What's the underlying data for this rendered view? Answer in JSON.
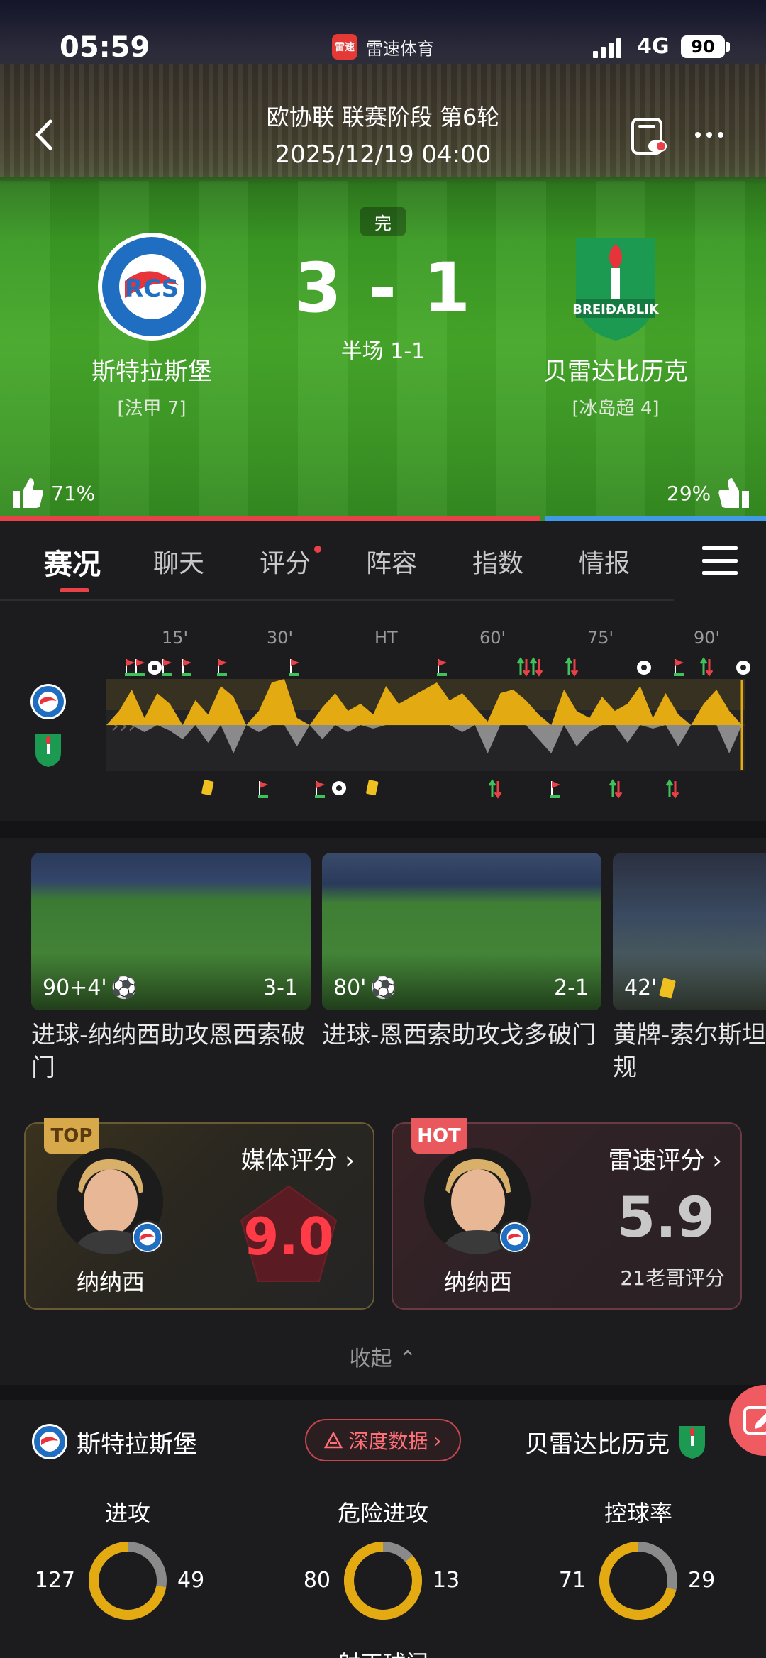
{
  "status_bar": {
    "time": "05:59",
    "app_name": "雷速体育",
    "app_logo_text": "雷速",
    "network": "4G",
    "battery": "90"
  },
  "header": {
    "competition": "欧协联 联赛阶段 第6轮",
    "datetime": "2025/12/19 04:00"
  },
  "match": {
    "status": "完",
    "score": "3 - 1",
    "halftime": "半场 1-1",
    "home": {
      "name": "斯特拉斯堡",
      "league": "[法甲 7]",
      "vote": "71%",
      "vote_value": 71
    },
    "away": {
      "name": "贝雷达比历克",
      "league": "[冰岛超 4]",
      "vote": "29%",
      "vote_value": 29
    }
  },
  "tabs": [
    {
      "label": "赛况",
      "active": true
    },
    {
      "label": "聊天"
    },
    {
      "label": "评分",
      "dot": true
    },
    {
      "label": "阵容"
    },
    {
      "label": "指数"
    },
    {
      "label": "情报"
    }
  ],
  "timeline": {
    "labels": [
      "15'",
      "30'",
      "HT",
      "60'",
      "75'",
      "90'"
    ],
    "colors": {
      "home": "#e4aa12",
      "away": "#8a8a8a",
      "corner": "#e84147",
      "sub_in": "#3fc25a",
      "yellow": "#f0c020"
    }
  },
  "highlights": [
    {
      "minute": "90+4'",
      "score": "3-1",
      "title": "进球-纳纳西助攻恩西索破门",
      "icon": "goal-icon"
    },
    {
      "minute": "80'",
      "score": "2-1",
      "title": "进球-恩西索助攻戈多破门",
      "icon": "goal-icon"
    },
    {
      "minute": "42'",
      "score": "",
      "title": "黄牌-索尔斯坦比历克) 犯规",
      "icon": "yellow-card-icon"
    }
  ],
  "ratings": {
    "media": {
      "ribbon": "TOP",
      "label": "媒体评分",
      "player": "纳纳西",
      "value": "9.0"
    },
    "fans": {
      "ribbon": "HOT",
      "label": "雷速评分",
      "player": "纳纳西",
      "value": "5.9",
      "count": "21老哥评分"
    }
  },
  "collapse_label": "收起",
  "stats": {
    "home_team": "斯特拉斯堡",
    "away_team": "贝雷达比历克",
    "deep_data": "深度数据",
    "items": [
      {
        "title": "进攻",
        "home": "127",
        "away": "49"
      },
      {
        "title": "危险进攻",
        "home": "80",
        "away": "13"
      },
      {
        "title": "控球率",
        "home": "71",
        "away": "29"
      }
    ],
    "next_title": "射正球门"
  }
}
